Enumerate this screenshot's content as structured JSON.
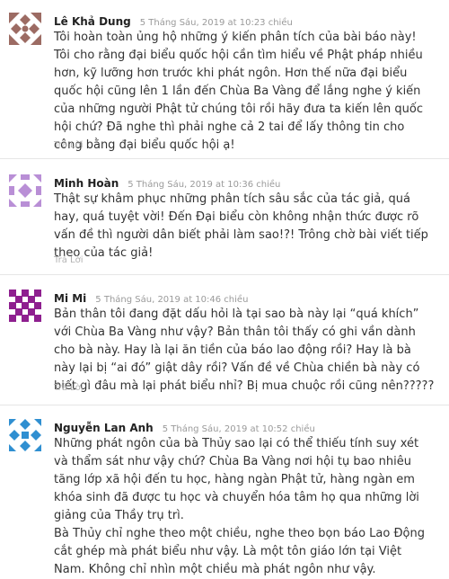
{
  "comments": [
    {
      "author": "Lê Khả Dung",
      "date": "5 Tháng Sáu, 2019 at 10:23 chiều",
      "paragraphs": [
        "Tôi hoàn toàn ủng hộ những ý kiến phân tích của bài báo này! Tôi cho rằng đại biểu quốc hội cần tìm hiểu về Phật pháp nhiều hơn, kỹ lưỡng hơn trước khi phát ngôn. Hơn thế nữa đại biểu quốc hội cũng lên 1 lần đến Chùa Ba Vàng để lắng nghe ý kiến của những người Phật tử chúng tôi rồi hãy đưa ta kiến lên quốc hội chứ? Đã nghe thì phải nghe cả 2 tai để lấy thông tin cho công bằng đại biểu quốc hội ạ!"
      ],
      "reply": "Trả Lời",
      "avatar_color": "#9c6b63"
    },
    {
      "author": "Minh Hoàn",
      "date": "5 Tháng Sáu, 2019 at 10:36 chiều",
      "paragraphs": [
        "Thật sự khâm phục những phân tích sâu sắc của tác giả, quá hay, quá tuyệt vời! Đến Đại biểu còn không nhận thức được rõ vấn đề thì người dân biết phải làm sao!?! Trông chờ bài viết tiếp theo của tác giả!"
      ],
      "reply": "Trả Lời",
      "avatar_color": "#b98fd6"
    },
    {
      "author": "Mi Mi",
      "date": "5 Tháng Sáu, 2019 at 10:46 chiều",
      "paragraphs": [
        "Bản thân tôi đang đặt dấu hỏi là tại sao bà này lại “quá khích” với Chùa Ba Vàng như vậy? Bản thân tôi thấy có ghi vần dành cho bà này. Hay là lại ăn tiền của báo lao động rồi? Hay là bà này lại bị “ai đó” giật dây rồi? Vấn đề về Chùa chiền bà này có biết gì đâu mà lại phát biểu nhỉ? Bị mua chuộc rồi cũng nên?????"
      ],
      "reply": "Trả Lời",
      "avatar_color": "#8e1f8f"
    },
    {
      "author": "Nguyễn Lan Anh",
      "date": "5 Tháng Sáu, 2019 at 10:52 chiều",
      "paragraphs": [
        "Những phát ngôn của bà Thủy sao lại có thể thiếu tính suy xét và thẩm sát như vậy chứ? Chùa Ba Vàng nơi hội tụ bao nhiêu tăng lớp xã hội đến tu học, hàng ngàn Phật tử, hàng ngàn em khóa sinh đã được tu học và chuyển hóa tâm họ qua những lời giảng của Thầy trụ trì.",
        "Bà Thủy chỉ nghe theo một chiều, nghe theo bọn báo Lao Động cắt ghép mà phát biểu như vậy. Là một tôn giáo lớn tại Việt Nam. Không chỉ nhìn một chiều mà phát ngôn như vậy."
      ],
      "reply": "",
      "avatar_color": "#2f8fd1"
    }
  ]
}
